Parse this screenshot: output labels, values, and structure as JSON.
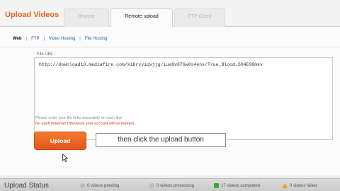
{
  "header": {
    "title": "Upload Videos",
    "tabs": [
      {
        "label": "Browse",
        "active": false
      },
      {
        "label": "Remote upload",
        "active": true
      },
      {
        "label": "FTP Client",
        "active": false
      }
    ]
  },
  "subnav": {
    "items": [
      {
        "label": "Web",
        "active": true
      },
      {
        "label": "FTP",
        "active": false
      },
      {
        "label": "Video Hosting",
        "active": false
      },
      {
        "label": "File Hosting",
        "active": false
      }
    ]
  },
  "form": {
    "file_url_label": "File URL:",
    "file_url_value": "http://download10.mediafire.com/kibryyiqvjjg/iua9v876w0s4enx/True.Blood.S04E06mkv",
    "hint": "Please enter your file links separately on each line",
    "warning": "No adult material! Otherwise your account will be banned.",
    "upload_label": "Upload"
  },
  "callout": {
    "text": "then click the upload button"
  },
  "status": {
    "title": "Upload Status",
    "pending": "0 videos pending",
    "processing": "0 videos processing",
    "completed": "17 videos completed",
    "failed": "0 videos failed"
  },
  "colors": {
    "accent": "#e8651c",
    "link": "#1f63b8",
    "warning": "#d93025",
    "success": "#3fa33f",
    "failed": "#e6a817"
  }
}
